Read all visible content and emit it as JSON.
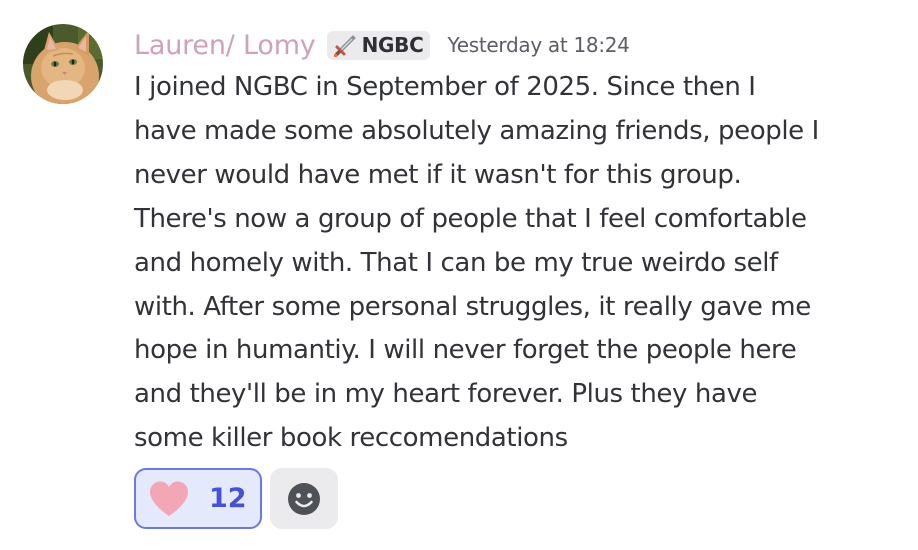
{
  "message": {
    "username": "Lauren/ Lomy",
    "tag": {
      "text": "NGBC",
      "icon": "sword-icon"
    },
    "timestamp": "Yesterday at 18:24",
    "text": "I joined NGBC in September of 2025. Since then I\nhave made some absolutely amazing friends, people I\nnever would have met if it wasn't for this group.\nThere's now a group of people that I feel comfortable\nand homely with. That I can be my true weirdo self\nwith. After some personal struggles, it really gave me\nhope in humantiy. I will never forget the people here\nand they'll be in my heart forever. Plus they have\nsome killer book reccomendations",
    "reactions": [
      {
        "icon": "heart-icon",
        "count": "12",
        "selected": true
      }
    ],
    "add_reaction_icon": "smiley-icon"
  },
  "colors": {
    "username": "#cfa2b9",
    "reaction_border": "#6a79e4",
    "reaction_bg": "#e5e9fc",
    "reaction_count": "#4652d6",
    "heart": "#f3a6b6"
  }
}
